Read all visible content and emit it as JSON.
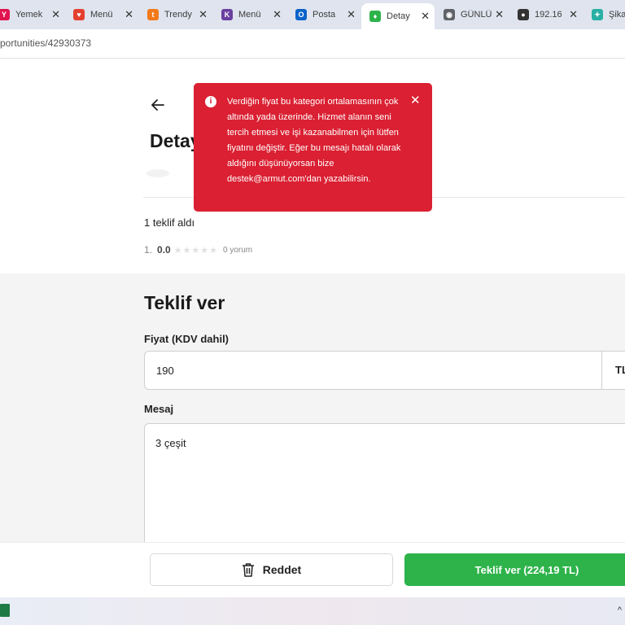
{
  "browser": {
    "tabs": [
      {
        "title": "Yemek",
        "icon": "yemeksepeti-icon",
        "color": "#e2134f",
        "glyph": "Y"
      },
      {
        "title": "Menü",
        "icon": "vivaldi-icon",
        "color": "#e5402f",
        "glyph": "♥"
      },
      {
        "title": "Trendy",
        "icon": "trendyol-icon",
        "color": "#f27a1a",
        "glyph": "t"
      },
      {
        "title": "Menü",
        "icon": "restaurant-icon",
        "color": "#6b3fa0",
        "glyph": "K"
      },
      {
        "title": "Posta",
        "icon": "outlook-icon",
        "color": "#0a64c9",
        "glyph": "O"
      },
      {
        "title": "Detay",
        "icon": "armut-icon",
        "color": "#2db34a",
        "glyph": "♦"
      },
      {
        "title": "GÜNLÜ",
        "icon": "globe-icon",
        "color": "#5f6368",
        "glyph": "◉"
      },
      {
        "title": "192.16",
        "icon": "router-icon",
        "color": "#333333",
        "glyph": "●"
      },
      {
        "title": "Şikay",
        "icon": "sikayetvar-icon",
        "color": "#28b0a5",
        "glyph": "✦"
      }
    ],
    "active_tab_index": 5,
    "url": "portunities/42930373"
  },
  "page": {
    "title": "Detay",
    "offers_count": "1 teklif aldı",
    "rating": {
      "rank": "1.",
      "score": "0.0",
      "stars": "★★★★★",
      "reviews": "0 yorum"
    }
  },
  "form": {
    "section_title": "Teklif ver",
    "price_label": "Fiyat (KDV dahil)",
    "price_value": "190",
    "currency": "TL",
    "message_label": "Mesaj",
    "message_value": "3 çeşit"
  },
  "footer": {
    "reject_label": "Reddet",
    "submit_label": "Teklif ver (224,19 TL)"
  },
  "toast": {
    "message": "Verdiğin fiyat bu kategori ortalamasının çok altında yada üzerinde. Hizmet alanın seni tercih etmesi ve işi kazanabilmen için lütfen fiyatını değiştir. Eğer bu mesajı hatalı olarak aldığını düşünüyorsan bize destek@armut.com'dan yazabilirsin.",
    "info_glyph": "i",
    "close_glyph": "✕"
  },
  "taskbar": {
    "caret_glyph": "^"
  },
  "colors": {
    "accent_green": "#2db34a",
    "error_red": "#da2032"
  }
}
